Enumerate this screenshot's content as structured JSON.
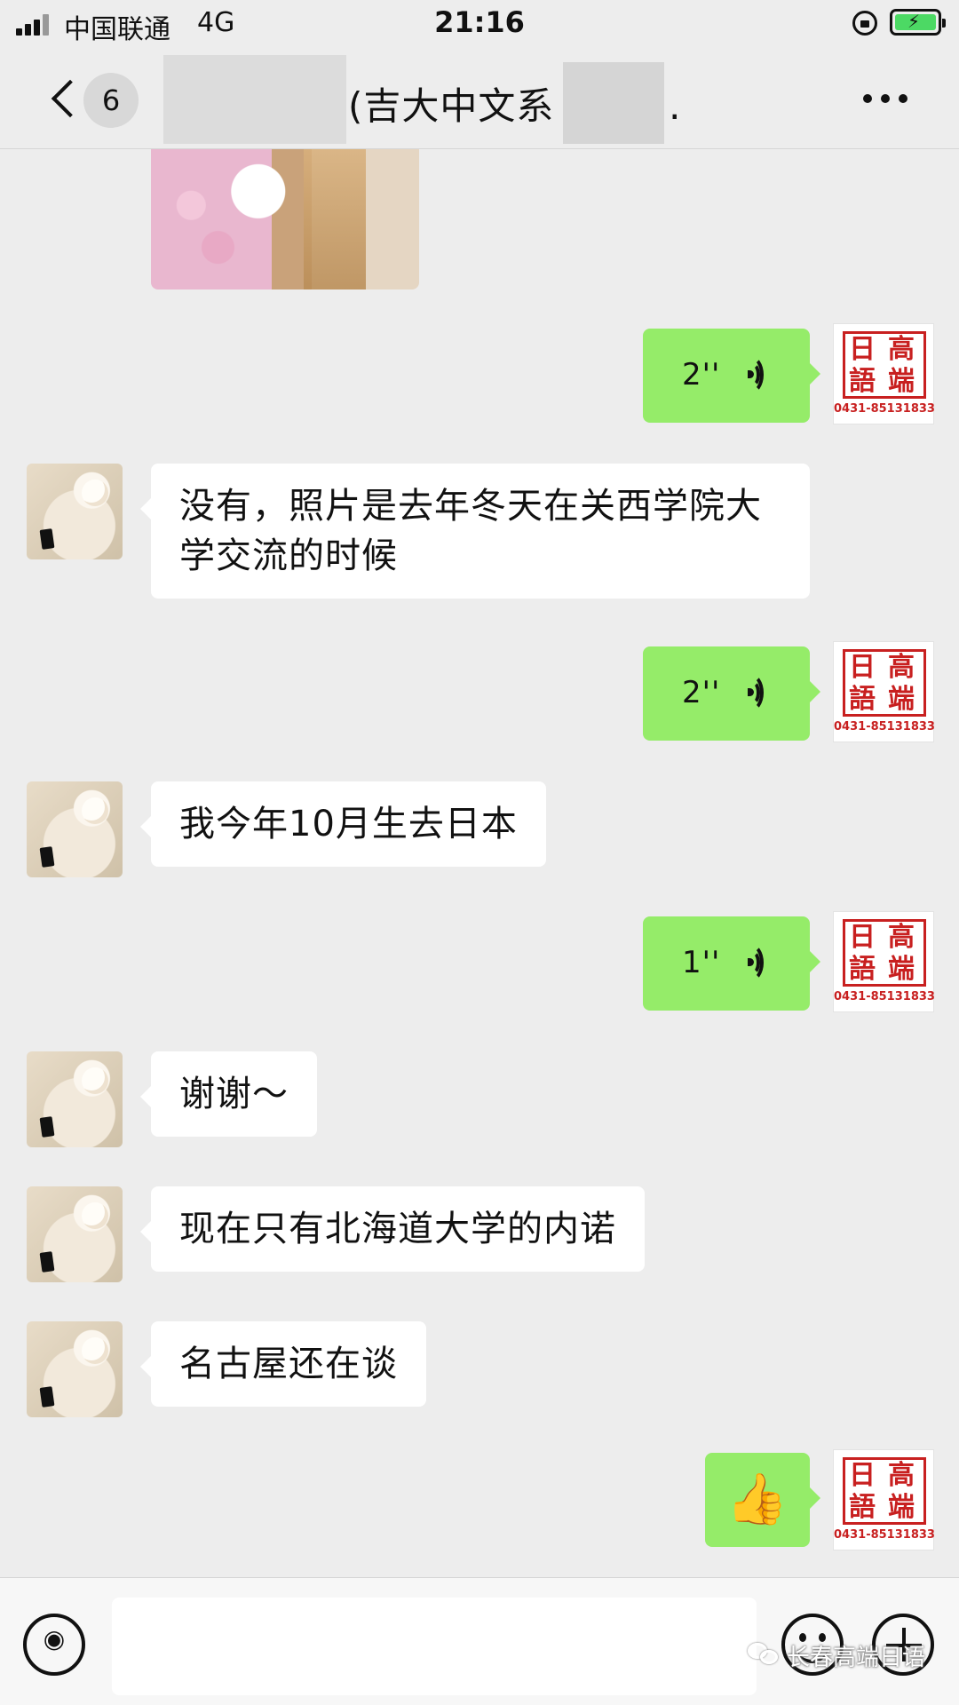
{
  "status_bar": {
    "carrier": "中国联通",
    "network": "4G",
    "time": "21:16"
  },
  "navbar": {
    "unread_count": "6",
    "title": "(吉大中文系      大二…"
  },
  "avatar_stamp": {
    "chars": [
      "日",
      "高",
      "語",
      "端"
    ],
    "phone": "0431-85131833"
  },
  "messages": [
    {
      "side": "right",
      "type": "voice",
      "duration": "2''"
    },
    {
      "side": "left",
      "type": "text",
      "text": "没有，照片是去年冬天在关西学院大学交流的时候"
    },
    {
      "side": "right",
      "type": "voice",
      "duration": "2''"
    },
    {
      "side": "left",
      "type": "text",
      "text": "我今年10月生去日本"
    },
    {
      "side": "right",
      "type": "voice",
      "duration": "1''"
    },
    {
      "side": "left",
      "type": "text",
      "text": "谢谢～"
    },
    {
      "side": "left",
      "type": "text",
      "text": "现在只有北海道大学的内诺"
    },
    {
      "side": "left",
      "type": "text",
      "text": "名古屋还在谈"
    },
    {
      "side": "right",
      "type": "emoji",
      "emoji": "👍"
    }
  ],
  "watermark": "长春高端日语",
  "icons": {
    "back": "chevron-left-icon",
    "more": "more-dots-icon",
    "voice_input": "voice-input-icon",
    "emoji": "emoji-icon",
    "plus": "plus-icon"
  }
}
